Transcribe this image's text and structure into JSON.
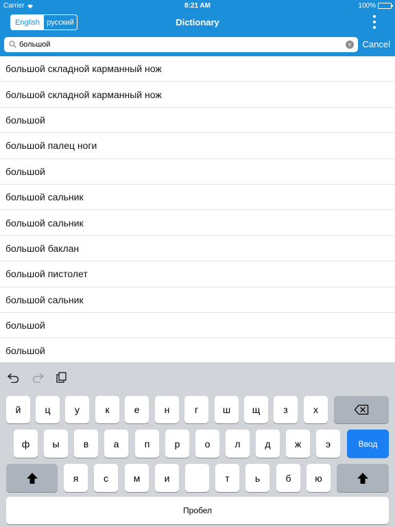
{
  "status_bar": {
    "carrier": "Carrier",
    "time": "8:21 AM",
    "battery": "100%"
  },
  "header": {
    "title": "Dictionary",
    "lang_english": "English",
    "lang_russian": "русский",
    "cancel_label": "Cancel"
  },
  "search": {
    "value": "большой",
    "clear_glyph": "×"
  },
  "results": [
    "большой складной карманный нож",
    "большой складной карманный нож",
    "большой",
    "большой палец ноги",
    "большой",
    "большой сальник",
    "большой сальник",
    "большой баклан",
    "большой пистолет",
    "большой сальник",
    "большой",
    "большой"
  ],
  "keyboard": {
    "row1": [
      "й",
      "ц",
      "у",
      "к",
      "е",
      "н",
      "г",
      "ш",
      "щ",
      "з",
      "х"
    ],
    "row2": [
      "ф",
      "ы",
      "в",
      "а",
      "п",
      "р",
      "о",
      "л",
      "д",
      "ж",
      "э"
    ],
    "row3": [
      "я",
      "с",
      "м",
      "и",
      "т",
      "ь",
      "б",
      "ю"
    ],
    "enter_label": "Ввод",
    "space_label": "Пробел"
  },
  "colors": {
    "accent": "#1b8fd9",
    "enter": "#1a7ff3",
    "keyboard_bg": "#d1d4d9"
  }
}
